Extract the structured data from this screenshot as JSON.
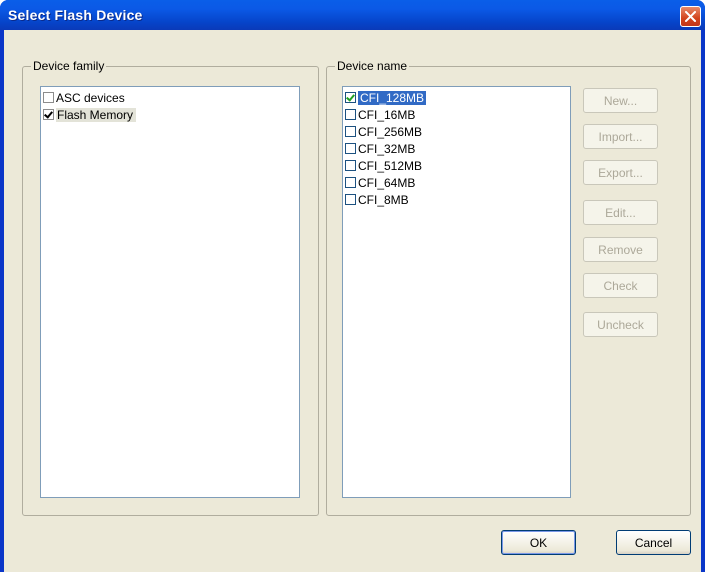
{
  "window": {
    "title": "Select Flash Device"
  },
  "device_family": {
    "group_label": "Device family",
    "items": [
      {
        "label": "ASC devices",
        "checked": false
      },
      {
        "label": "Flash Memory",
        "checked": true
      }
    ]
  },
  "device_name": {
    "group_label": "Device name",
    "items": [
      {
        "label": "CFI_128MB",
        "checked": true,
        "selected": true
      },
      {
        "label": "CFI_16MB",
        "checked": false
      },
      {
        "label": "CFI_256MB",
        "checked": false
      },
      {
        "label": "CFI_32MB",
        "checked": false
      },
      {
        "label": "CFI_512MB",
        "checked": false
      },
      {
        "label": "CFI_64MB",
        "checked": false
      },
      {
        "label": "CFI_8MB",
        "checked": false
      }
    ]
  },
  "side_buttons": {
    "new_label": "New...",
    "import_label": "Import...",
    "export_label": "Export...",
    "edit_label": "Edit...",
    "remove_label": "Remove",
    "check_label": "Check",
    "uncheck_label": "Uncheck"
  },
  "footer": {
    "ok_label": "OK",
    "cancel_label": "Cancel"
  },
  "colors": {
    "titlebar": "#0b59e6",
    "client_bg": "#ece9d8",
    "selection": "#316ac5",
    "close_button": "#d2431c"
  }
}
